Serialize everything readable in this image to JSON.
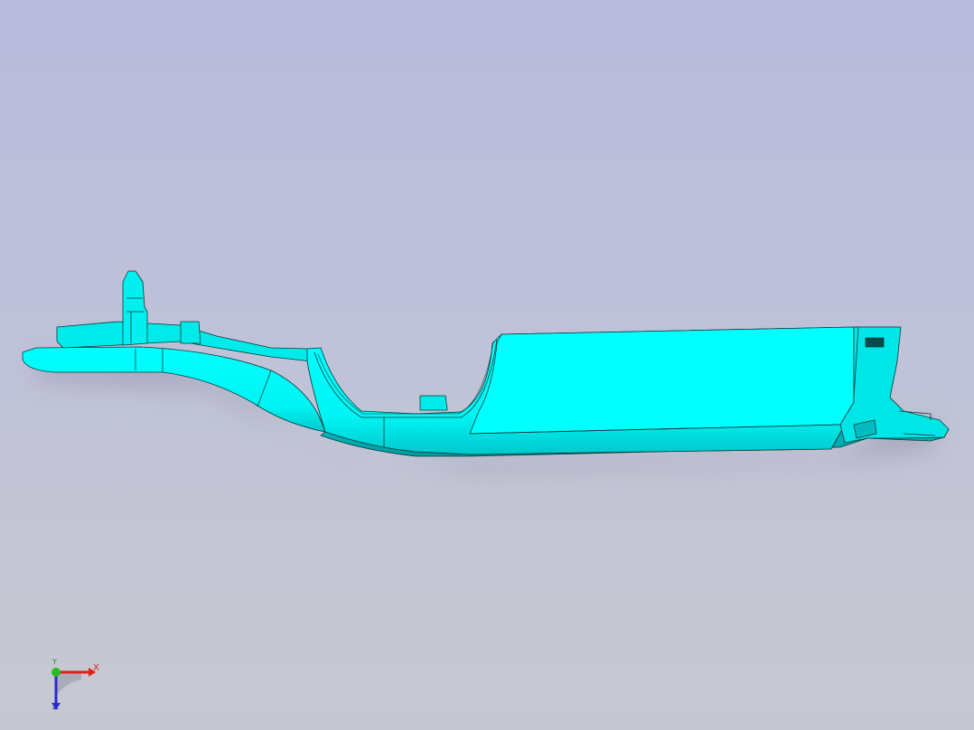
{
  "viewport": {
    "background_top": "#b9badc",
    "background_bottom": "#c6c8d1"
  },
  "model": {
    "fill_color": "#00ffff",
    "shadow_color": "#00c8c8",
    "edge_color": "#0a3a3a"
  },
  "triad": {
    "x_label": "X",
    "y_label": "Y",
    "z_label": "Z",
    "x_color": "#e0201a",
    "y_color": "#22c022",
    "z_color": "#2a2ad0"
  }
}
